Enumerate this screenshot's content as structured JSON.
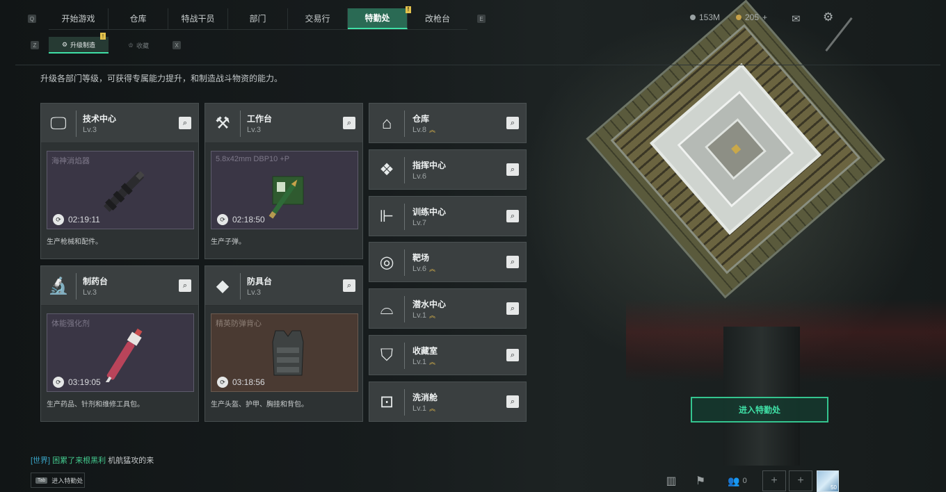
{
  "nav": {
    "left_key": "Q",
    "right_key": "E",
    "tabs": [
      "开始游戏",
      "仓库",
      "特战干员",
      "部门",
      "交易行",
      "特勤处",
      "改枪台"
    ],
    "active_tab": "特勤处",
    "badge": "!"
  },
  "subnav": {
    "left_key": "Z",
    "right_key": "X",
    "tabs": [
      "升级制造",
      "收藏"
    ],
    "badge": "!"
  },
  "resources": {
    "currency": "153M",
    "secondary": "205",
    "plus": "+"
  },
  "description": "升级各部门等级，可获得专属能力提升，和制造战斗物资的能力。",
  "workshops": [
    {
      "name": "技术中心",
      "level": "Lv.3",
      "product": "海神消焰器",
      "timer": "02:19:11",
      "caption": "生产枪械和配件。",
      "icon": "monitor-icon"
    },
    {
      "name": "工作台",
      "level": "Lv.3",
      "product": "5.8x42mm DBP10 +P",
      "timer": "02:18:50",
      "caption": "生产子弹。",
      "icon": "tools-icon"
    },
    {
      "name": "制药台",
      "level": "Lv.3",
      "product": "体能强化剂",
      "timer": "03:19:05",
      "caption": "生产药品、针剂和维修工具包。",
      "icon": "microscope-icon"
    },
    {
      "name": "防具台",
      "level": "Lv.3",
      "product": "精英防弹背心",
      "timer": "03:18:56",
      "caption": "生产头盔、护甲、胸挂和背包。",
      "icon": "armor-icon"
    }
  ],
  "departments": [
    {
      "name": "仓库",
      "level": "Lv.8",
      "upgrade": true,
      "icon": "warehouse-icon"
    },
    {
      "name": "指挥中心",
      "level": "Lv.6",
      "upgrade": false,
      "icon": "command-icon"
    },
    {
      "name": "训练中心",
      "level": "Lv.7",
      "upgrade": false,
      "icon": "dumbbell-icon"
    },
    {
      "name": "靶场",
      "level": "Lv.6",
      "upgrade": true,
      "icon": "target-icon"
    },
    {
      "name": "潜水中心",
      "level": "Lv.1",
      "upgrade": true,
      "icon": "diving-icon"
    },
    {
      "name": "收藏室",
      "level": "Lv.1",
      "upgrade": true,
      "icon": "collection-icon"
    },
    {
      "name": "洗消舱",
      "level": "Lv.1",
      "upgrade": true,
      "icon": "decon-icon"
    }
  ],
  "enter_button": "进入特勤处",
  "chat": {
    "channel": "[世界]",
    "name": "困累了来根黑利",
    "message": "机航猛攻的来"
  },
  "tab_hint": {
    "key": "Tab",
    "label": "进入特勤处"
  },
  "bottom": {
    "friends_count": "0",
    "avatar_level": "50"
  },
  "colors": {
    "accent": "#3fe0a6",
    "tab_active": "#2a6a54",
    "gold": "#e0b84a"
  }
}
